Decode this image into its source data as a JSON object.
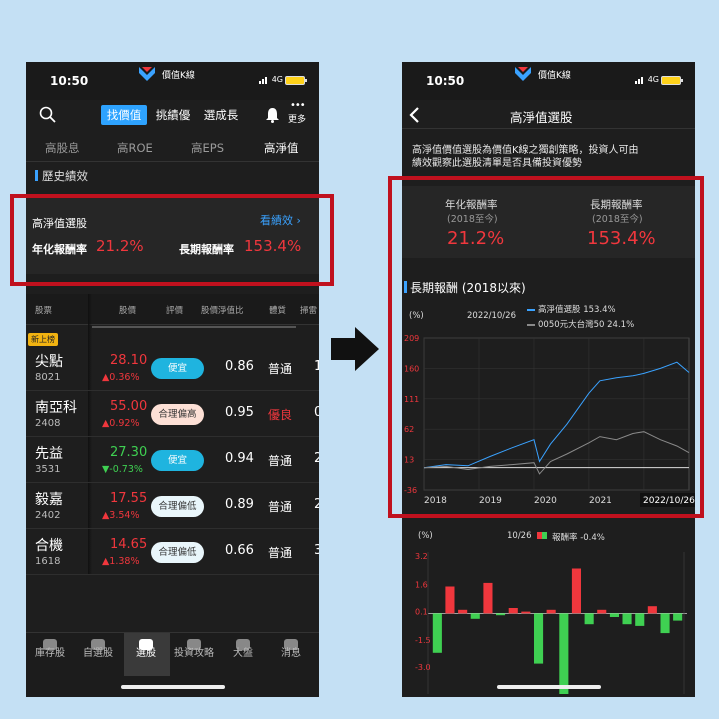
{
  "left": {
    "time": "10:50",
    "app_name": "價值K線",
    "network": "4G",
    "top_tabs": [
      "找價值",
      "挑績優",
      "選成長"
    ],
    "more_label": "更多",
    "sub_tabs": [
      "高股息",
      "高ROE",
      "高EPS",
      "高淨值"
    ],
    "section_title": "歷史績效",
    "card": {
      "title": "高淨值選股",
      "link": "看績效 ›",
      "annual_label": "年化報酬率",
      "annual_value": "21.2%",
      "long_label": "長期報酬率",
      "long_value": "153.4%"
    },
    "table_headers": [
      "股票",
      "股價",
      "評價",
      "股價淨值比",
      "體質",
      "掃雷"
    ],
    "badge": "新上榜",
    "rows": [
      {
        "name": "尖點",
        "code": "8021",
        "price": "28.10",
        "change": "▲0.36%",
        "dir": "up",
        "rating": "便宜",
        "pb": "0.86",
        "health": "普通",
        "extra": "1"
      },
      {
        "name": "南亞科",
        "code": "2408",
        "price": "55.00",
        "change": "▲0.92%",
        "dir": "up",
        "rating": "合理偏高",
        "pb": "0.95",
        "health": "優良",
        "extra": "0"
      },
      {
        "name": "先益",
        "code": "3531",
        "price": "27.30",
        "change": "▼-0.73%",
        "dir": "down",
        "rating": "便宜",
        "pb": "0.94",
        "health": "普通",
        "extra": "2"
      },
      {
        "name": "毅嘉",
        "code": "2402",
        "price": "17.55",
        "change": "▲3.54%",
        "dir": "up",
        "rating": "合理偏低",
        "pb": "0.89",
        "health": "普通",
        "extra": "2"
      },
      {
        "name": "合機",
        "code": "1618",
        "price": "14.65",
        "change": "▲1.38%",
        "dir": "up",
        "rating": "合理偏低",
        "pb": "0.66",
        "health": "普通",
        "extra": "3"
      }
    ],
    "nav": [
      "庫存股",
      "自選股",
      "選股",
      "投資攻略",
      "大盤",
      "消息"
    ]
  },
  "right": {
    "time": "10:50",
    "app_name": "價值K線",
    "network": "4G",
    "title": "高淨值選股",
    "desc_line1": "高淨值價值選股為價值K線之獨創策略，投資人可由",
    "desc_line2": "績效觀察此選股清單是否具備投資優勢",
    "annual_label": "年化報酬率",
    "annual_sub": "(2018至今)",
    "annual_value": "21.2%",
    "long_label": "長期報酬率",
    "long_sub": "(2018至今)",
    "long_value": "153.4%",
    "chart_title": "長期報酬 (2018以來)",
    "bar_unit": "(%)",
    "bar_date": "10/26",
    "bar_legend": "報酬率 -0.4%"
  },
  "colors": {
    "up": "#f0373d",
    "down": "#3fd052",
    "accent": "#3aa2ff",
    "highlight_box": "#c0111e"
  },
  "chart_data": [
    {
      "type": "line",
      "title": "長期報酬 (2018以來)",
      "unit": "(%)",
      "date_label": "2022/10/26",
      "x_ticks": [
        "2018",
        "2019",
        "2020",
        "2021",
        "20",
        "2022/10/26"
      ],
      "ylim": [
        -36,
        209
      ],
      "y_ticks": [
        "209",
        "160",
        "111",
        "62",
        "13",
        "-36"
      ],
      "x_years": [
        2018,
        2018.4,
        2018.8,
        2019.2,
        2019.6,
        2020,
        2020.1,
        2020.3,
        2020.6,
        2021,
        2021.2,
        2021.5,
        2021.8,
        2022,
        2022.3,
        2022.6,
        2022.82
      ],
      "series": [
        {
          "name": "高淨值選股 153.4%",
          "color": "#3aa2ff",
          "values": [
            0,
            5,
            3,
            18,
            32,
            45,
            10,
            38,
            70,
            120,
            140,
            145,
            148,
            152,
            160,
            170,
            153.4
          ]
        },
        {
          "name": "0050元大台灣50 24.1%",
          "color": "#8a8a8a",
          "values": [
            0,
            2,
            -3,
            2,
            5,
            8,
            -10,
            10,
            22,
            40,
            50,
            45,
            55,
            58,
            45,
            35,
            24.1
          ]
        }
      ]
    },
    {
      "type": "bar",
      "title": "報酬率 -0.4%",
      "unit": "(%)",
      "date_label": "10/26",
      "ylim": [
        -4.5,
        3.2
      ],
      "y_ticks": [
        "3.2",
        "1.6",
        "0.1",
        "-1.5",
        "-3.0"
      ],
      "values": [
        -2.2,
        1.5,
        0.2,
        -0.3,
        1.7,
        -0.1,
        0.3,
        0.1,
        -2.8,
        0.2,
        -4.5,
        2.5,
        -0.6,
        0.2,
        -0.2,
        -0.6,
        -0.7,
        0.4,
        -1.1,
        -0.4
      ]
    }
  ]
}
